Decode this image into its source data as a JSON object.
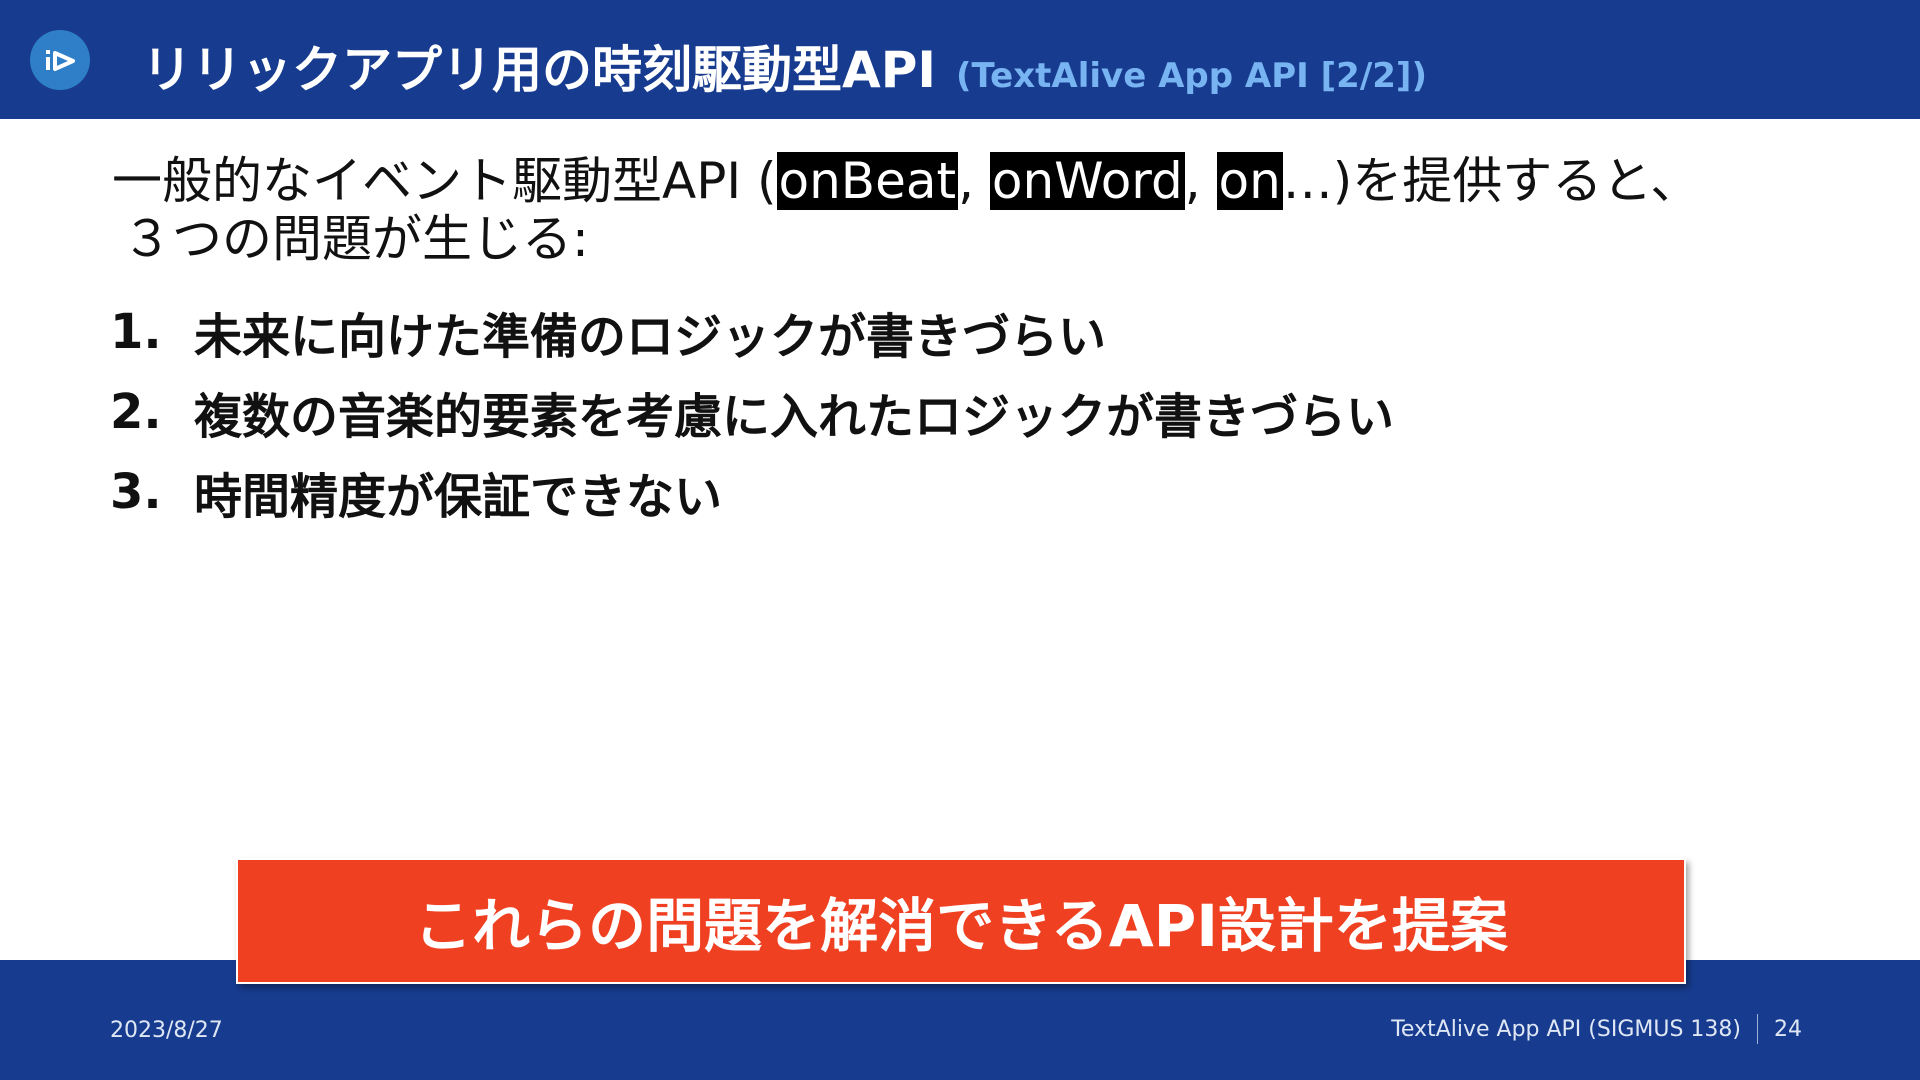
{
  "header": {
    "logo_icon": "textalive-logo-icon",
    "title": "リリックアプリ用の時刻駆動型API",
    "subtitle": "(TextAlive App API [2/2])",
    "bg_color": "#173c8f",
    "subtitle_color": "#79b4f2"
  },
  "intro": {
    "part1": "一般的なイベント駆動型API (",
    "code1": "onBeat",
    "sep1": ", ",
    "code2": "onWord",
    "sep2": ", ",
    "code3": "on",
    "part2": "…)を提供すると、",
    "line2": "３つの問題が生じる:"
  },
  "problems": [
    {
      "num": "1.",
      "text": "未来に向けた準備のロジックが書きづらい"
    },
    {
      "num": "2.",
      "text": "複数の音楽的要素を考慮に入れたロジックが書きづらい"
    },
    {
      "num": "3.",
      "text": "時間精度が保証できない"
    }
  ],
  "callout": {
    "text": "これらの問題を解消できるAPI設計を提案",
    "bg_color": "#ef4122"
  },
  "footer": {
    "date": "2023/8/27",
    "title": "TextAlive App API (SIGMUS 138)",
    "page": "24"
  }
}
